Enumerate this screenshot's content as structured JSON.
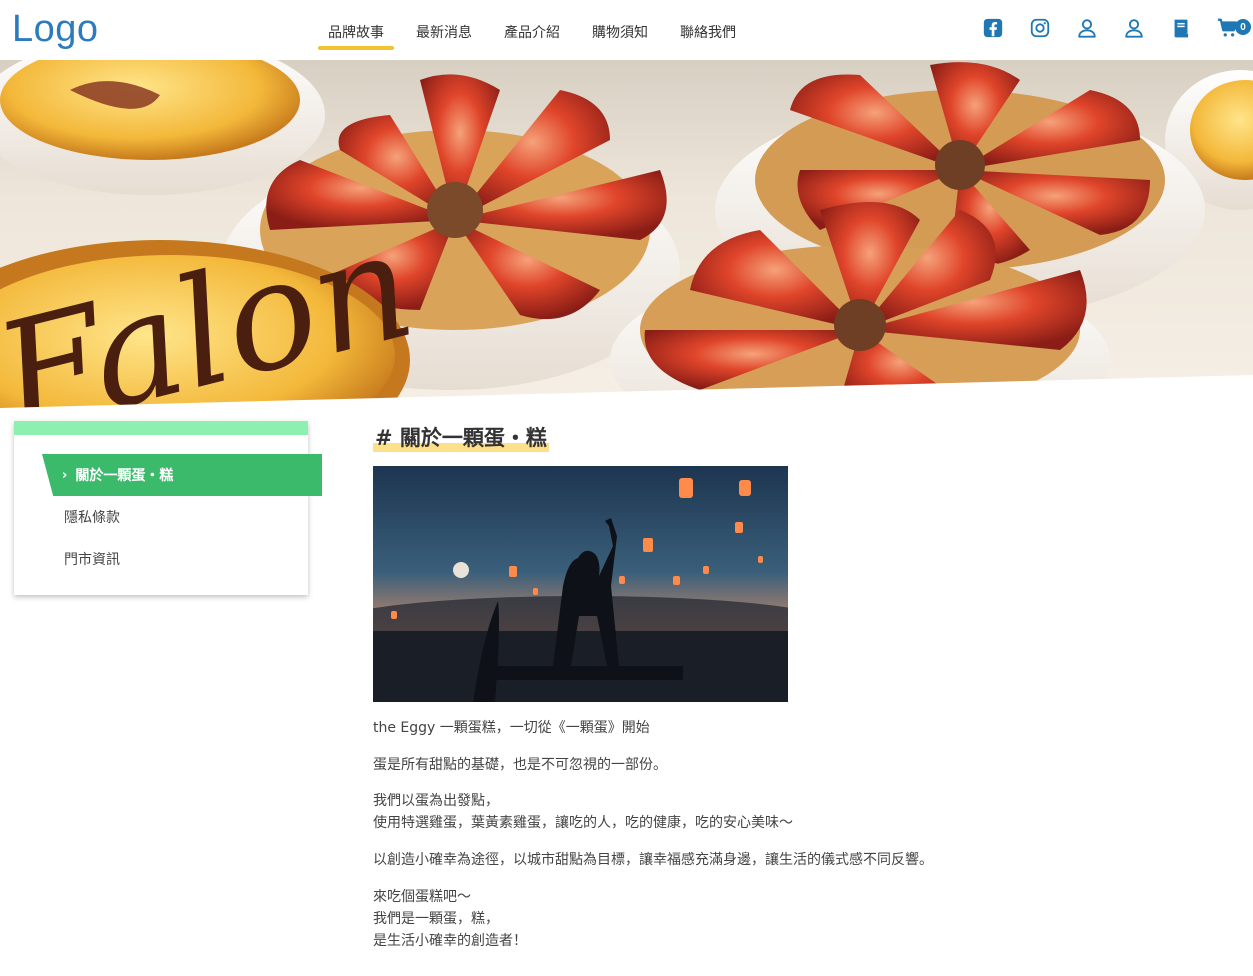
{
  "header": {
    "logo": "Logo",
    "nav": [
      {
        "label": "品牌故事",
        "active": true
      },
      {
        "label": "最新消息",
        "active": false
      },
      {
        "label": "產品介紹",
        "active": false
      },
      {
        "label": "購物須知",
        "active": false
      },
      {
        "label": "聯絡我們",
        "active": false
      }
    ],
    "icons": [
      "facebook-icon",
      "instagram-icon",
      "user-icon",
      "user-icon",
      "book-icon",
      "cart-icon"
    ],
    "cart_count": "0",
    "accent_color": "#1f78b4",
    "nav_underline_color": "#f4c430"
  },
  "hero": {
    "tart_lettering": "Falon"
  },
  "sidebar": {
    "items": [
      {
        "label": "關於一顆蛋・糕",
        "active": true
      },
      {
        "label": "隱私條款",
        "active": false
      },
      {
        "label": "門市資訊",
        "active": false
      }
    ],
    "active_color": "#3bba6b",
    "top_border_color": "#8ef0b0"
  },
  "content": {
    "title": "# 關於一顆蛋・糕",
    "paragraphs": [
      [
        "the Eggy 一顆蛋糕，一切從《一顆蛋》開始"
      ],
      [
        "蛋是所有甜點的基礎，也是不可忽視的一部份。"
      ],
      [
        "我們以蛋為出發點，",
        "使用特選雞蛋，葉黃素雞蛋，讓吃的人，吃的健康，吃的安心美味～"
      ],
      [
        "以創造小確幸為途徑，以城市甜點為目標，讓幸福感充滿身邊，讓生活的儀式感不同反響。"
      ],
      [
        "來吃個蛋糕吧～",
        "我們是一顆蛋，糕，",
        "是生活小確幸的創造者！"
      ]
    ]
  }
}
